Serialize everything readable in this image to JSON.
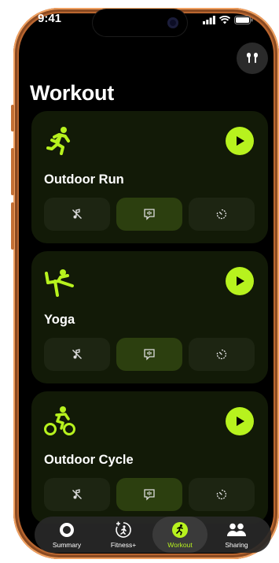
{
  "status_bar": {
    "time": "9:41"
  },
  "page": {
    "title": "Workout"
  },
  "workouts": [
    {
      "name": "Outdoor Run",
      "icon": "running-figure-icon"
    },
    {
      "name": "Yoga",
      "icon": "yoga-figure-icon"
    },
    {
      "name": "Outdoor Cycle",
      "icon": "cycling-figure-icon"
    }
  ],
  "card_actions": [
    "music-off-icon",
    "voice-feedback-icon",
    "timer-icon"
  ],
  "tabbar": {
    "tabs": [
      {
        "label": "Summary",
        "icon": "activity-ring-icon"
      },
      {
        "label": "Fitness+",
        "icon": "fitness-plus-icon"
      },
      {
        "label": "Workout",
        "icon": "workout-runner-icon",
        "active": true
      },
      {
        "label": "Sharing",
        "icon": "people-icon"
      }
    ]
  },
  "colors": {
    "accent": "#b7f21e",
    "card_bg": "#121a07",
    "frame": "#b8652f"
  }
}
